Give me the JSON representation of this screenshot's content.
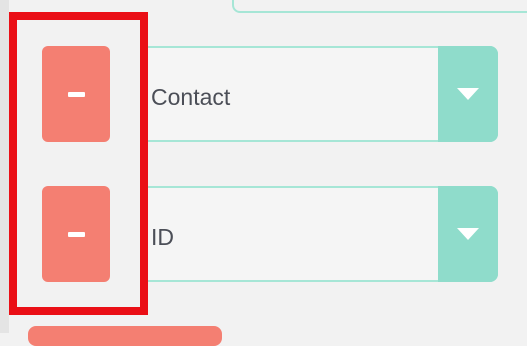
{
  "rows": [
    {
      "field_value": "Contact",
      "remove_icon": "minus-icon",
      "dropdown_icon": "chevron-down-icon"
    },
    {
      "field_value": "ID",
      "remove_icon": "minus-icon",
      "dropdown_icon": "chevron-down-icon"
    }
  ],
  "colors": {
    "remove_button": "#f47f72",
    "dropdown_arrow_bg": "#8fdccb",
    "field_border": "#a6e6d6",
    "highlight_box": "#ea0f16",
    "text": "#4b4e57"
  }
}
